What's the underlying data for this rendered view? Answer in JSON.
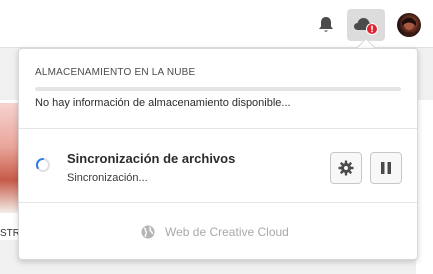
{
  "header": {
    "notifications_icon": "bell-icon",
    "cloud_icon": "cloud-alert-icon",
    "avatar": "user-avatar"
  },
  "background": {
    "partial_text": "STRA"
  },
  "popover": {
    "storage": {
      "title": "ALMACENAMIENTO EN LA NUBE",
      "message": "No hay información de almacenamiento disponible..."
    },
    "sync": {
      "title": "Sincronización de archivos",
      "status": "Sincronización...",
      "settings_icon": "gear-icon",
      "pause_icon": "pause-icon"
    },
    "footer": {
      "link_label": "Web de Creative Cloud",
      "link_icon": "globe-icon"
    }
  },
  "colors": {
    "alert_red": "#e0232e",
    "spinner_blue": "#2d7be5",
    "link_gray": "#a9a9a9"
  }
}
